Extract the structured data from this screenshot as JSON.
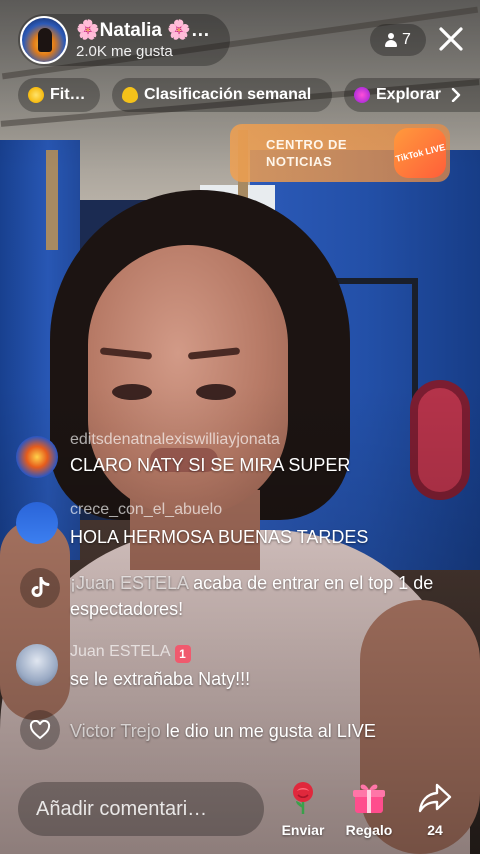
{
  "host": {
    "name": "🌸Natalia 🌸…",
    "likes": "2.0K me gusta"
  },
  "viewers": {
    "count": "7"
  },
  "chips": [
    {
      "label": "Fit…",
      "icon": "coin-icon"
    },
    {
      "label": "Clasificación semanal",
      "icon": "flame-icon"
    },
    {
      "label": "Explorar",
      "icon": "explore-orb-icon"
    }
  ],
  "news_banner": {
    "title": "CENTRO DE NOTICIAS",
    "badge": "TikTok LIVE"
  },
  "chat": [
    {
      "type": "message",
      "user": "editsdenatnalexiswilliayjonata",
      "text": "CLARO NATY SI SE MIRA SUPER"
    },
    {
      "type": "message",
      "user": "crece_con_el_abuelo",
      "text": "HOLA HERMOSA BUENAS TARDES"
    },
    {
      "type": "system",
      "who": "¡Juan ESTELA",
      "text": " acaba de entrar en el top 1 de espectadores!"
    },
    {
      "type": "message",
      "user": "Juan ESTELA",
      "badge": "1",
      "text": "se le extrañaba Naty!!!"
    },
    {
      "type": "like",
      "who": "Victor Trejo",
      "text": " le dio un me gusta al LIVE"
    }
  ],
  "bottom": {
    "comment_placeholder": "Añadir comentari…",
    "send_label": "Enviar",
    "gift_label": "Regalo",
    "share_count": "24"
  },
  "colors": {
    "pill_bg": "rgba(0,0,0,0.28)",
    "news_orange": "#f0a050",
    "gift_pink": "#ff4d8d",
    "rose_red": "#e0283c"
  }
}
